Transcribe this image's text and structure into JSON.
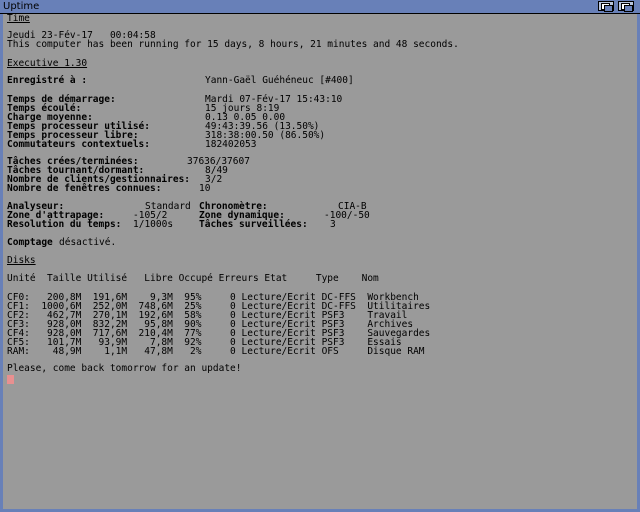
{
  "window": {
    "title": "Uptime"
  },
  "time": {
    "heading": "Time",
    "datetime": "Jeudi 23-Fév-17   00:04:58",
    "running": "This computer has been running for 15 days, 8 hours, 21 minutes and 48 seconds."
  },
  "executive": {
    "heading": "Executive 1.30",
    "registered_label": "Enregistré à :",
    "registered_value": "Yann-Gaël Guéhéneuc [#400]",
    "stats": [
      {
        "label": "Temps de démarrage:",
        "value": "Mardi 07-Fév-17 15:43:10"
      },
      {
        "label": "Temps écoulé:",
        "value": "15 jours 8:19"
      },
      {
        "label": "Charge moyenne:",
        "value": "0.13 0.05 0.00"
      },
      {
        "label": "Temps processeur utilisé:",
        "value": "49:43:39.56 (13.50%)"
      },
      {
        "label": "Temps processeur libre:",
        "value": "318:38:00.50 (86.50%)"
      },
      {
        "label": "Commutateurs contextuels:",
        "value": "182402053"
      }
    ],
    "tasks": [
      {
        "label": "Tâches crées/terminées:",
        "value": "37636/37607"
      },
      {
        "label": "Tâches tournant/dormant:",
        "value": "8/49"
      },
      {
        "label": "Nombre de clients/gestionnaires:",
        "value": "3/2"
      },
      {
        "label": "Nombre de fenêtres connues:",
        "value": "10"
      }
    ],
    "analyseur_label": "Analyseur:",
    "analyseur_value": "Standard",
    "chrono_label": "Chronomètre:",
    "chrono_value": "CIA-B",
    "zone_label": "Zone d'attrapage:",
    "zone_value": "-105/2",
    "zonedyn_label": "Zone dynamique:",
    "zonedyn_value": "-100/-50",
    "resolution_label": "Resolution du temps:",
    "resolution_value": "1/1000s",
    "surv_label": "Tâches surveillées:",
    "surv_value": "3",
    "comptage_label": "Comptage",
    "comptage_value": "désactivé."
  },
  "disks": {
    "heading": "Disks",
    "header": "Unité  Taille Utilisé   Libre Occupé Erreurs Etat     Type    Nom",
    "rows": [
      "CF0:   200,8M  191,6M    9,3M  95%     0 Lecture/Ecrit DC-FFS  Workbench",
      "CF1:  1000,6M  252,0M  748,6M  25%     0 Lecture/Ecrit DC-FFS  Utilitaires",
      "CF2:   462,7M  270,1M  192,6M  58%     0 Lecture/Ecrit PSF3    Travail",
      "CF3:   928,0M  832,2M   95,8M  90%     0 Lecture/Ecrit PSF3    Archives",
      "CF4:   928,0M  717,6M  210,4M  77%     0 Lecture/Ecrit PSF3    Sauvegardes",
      "CF5:   101,7M   93,9M    7,8M  92%     0 Lecture/Ecrit PSF3    Essais",
      "RAM:    48,9M    1,1M   47,8M   2%     0 Lecture/Ecrit OFS     Disque RAM"
    ]
  },
  "footer": {
    "message": "Please, come back tomorrow for an update!"
  },
  "colors": {
    "titlebar": "#6880b8",
    "background": "#9a9a9a",
    "cursor": "#e89090"
  }
}
